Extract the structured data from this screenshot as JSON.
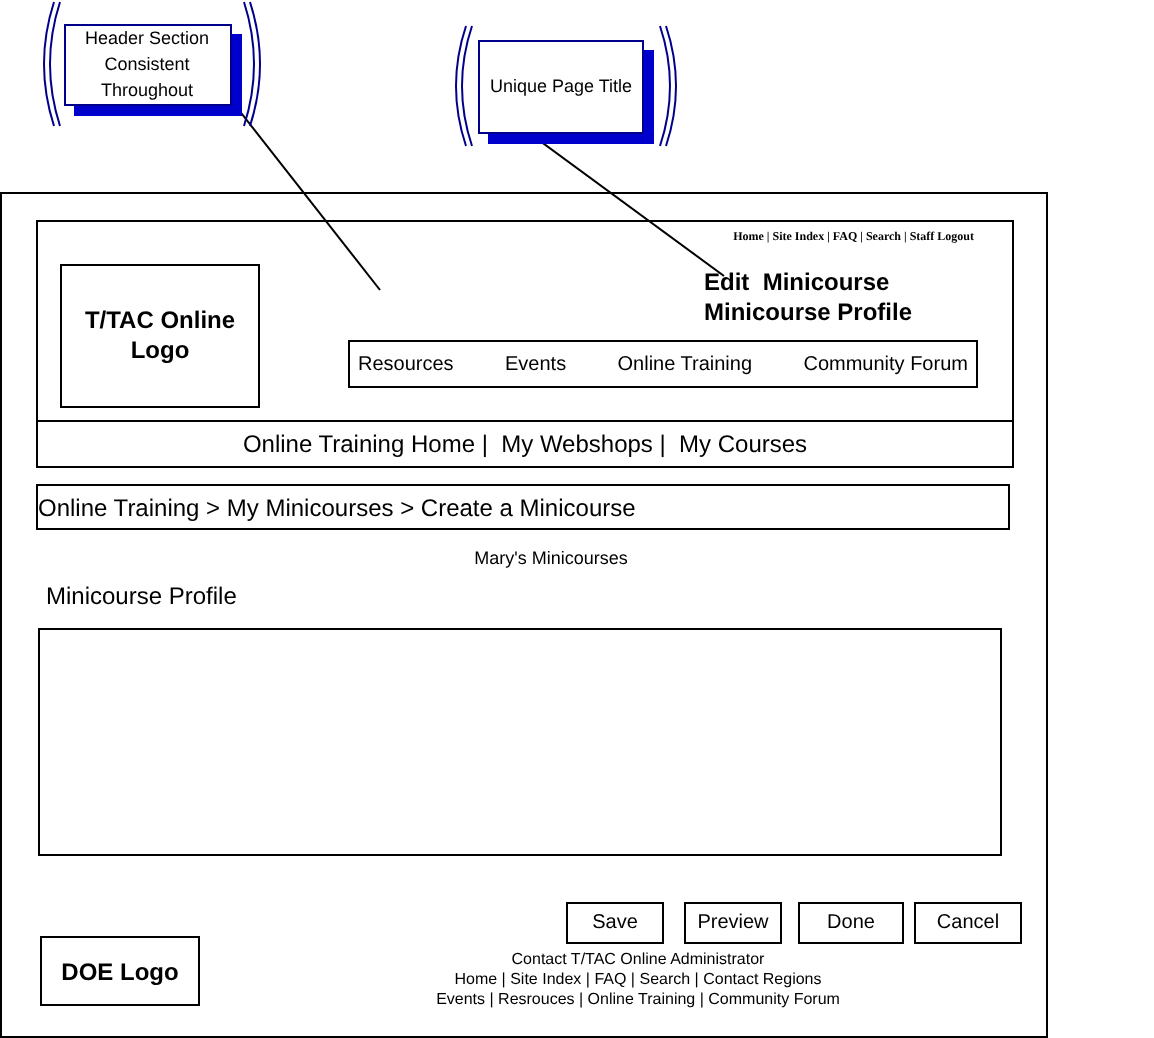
{
  "callouts": [
    {
      "text": "Header Section Consistent Throughout"
    },
    {
      "text": "Unique Page Title"
    }
  ],
  "header": {
    "logo": "T/TAC Online Logo",
    "utility_links": "Home | Site Index | FAQ | Search | Staff Logout",
    "page_title": [
      "Edit  Minicourse",
      "Minicourse Profile"
    ],
    "main_nav": [
      "Resources",
      "Events",
      "Online Training",
      "Community Forum"
    ]
  },
  "sub_nav": "Online Training Home |  My Webshops |  My Courses",
  "breadcrumb": "Online Training > My Minicourses > Create a Minicourse",
  "owner": "Mary's Minicourses",
  "section_title": "Minicourse Profile",
  "buttons": [
    "Save",
    "Preview",
    "Done",
    "Cancel"
  ],
  "footer": {
    "logo": "DOE Logo",
    "contact": "Contact T/TAC Online Administrator",
    "links": [
      "Home | Site Index | FAQ | Search | Contact Regions",
      "Events | Resrouces | Online Training | Community Forum"
    ]
  }
}
